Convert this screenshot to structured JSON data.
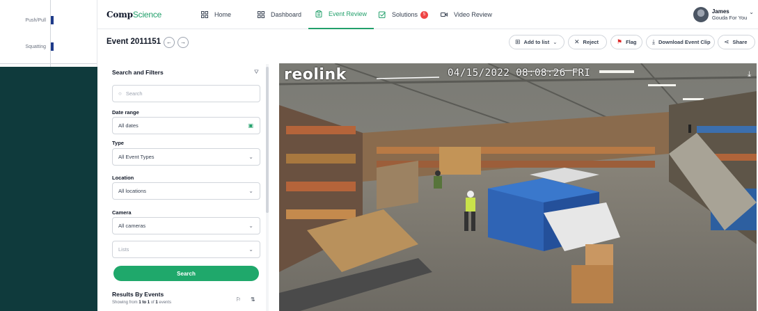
{
  "background_app": {
    "rows": [
      {
        "label": "Push/Pull"
      },
      {
        "label": "Squatting"
      }
    ]
  },
  "nav": {
    "logo_main": "Comp",
    "logo_accent": "Science",
    "items": [
      {
        "label": "Home",
        "icon": "home-icon"
      },
      {
        "label": "Dashboard",
        "icon": "grid-icon"
      },
      {
        "label": "Event Review",
        "icon": "clipboard-icon",
        "active": true
      },
      {
        "label": "Solutions",
        "icon": "check-square-icon",
        "badge": "5"
      },
      {
        "label": "Video Review",
        "icon": "video-icon"
      }
    ],
    "user": {
      "name": "James",
      "org": "Gouda For You"
    }
  },
  "event": {
    "title": "Event 2011151",
    "actions": {
      "add_to_list": "Add to list",
      "reject": "Reject",
      "flag": "Flag",
      "download": "Download Event Clip",
      "share": "Share"
    }
  },
  "filters": {
    "title": "Search and Filters",
    "search_placeholder": "Search",
    "date_label": "Date range",
    "date_value": "All dates",
    "type_label": "Type",
    "type_value": "All Event Types",
    "location_label": "Location",
    "location_value": "All locations",
    "camera_label": "Camera",
    "camera_value": "All cameras",
    "lists_placeholder": "Lists",
    "search_button": "Search",
    "results_title": "Results By Events",
    "results_prefix": "Showing from ",
    "results_range": "1 to 1",
    "results_of": " of ",
    "results_count": "1",
    "results_suffix": " events"
  },
  "video": {
    "brand": "reolink",
    "timestamp": "04/15/2022 08:08:26 FRI"
  },
  "colors": {
    "accent": "#22a06b",
    "badge": "#ef4444",
    "flag": "#dc2626"
  }
}
